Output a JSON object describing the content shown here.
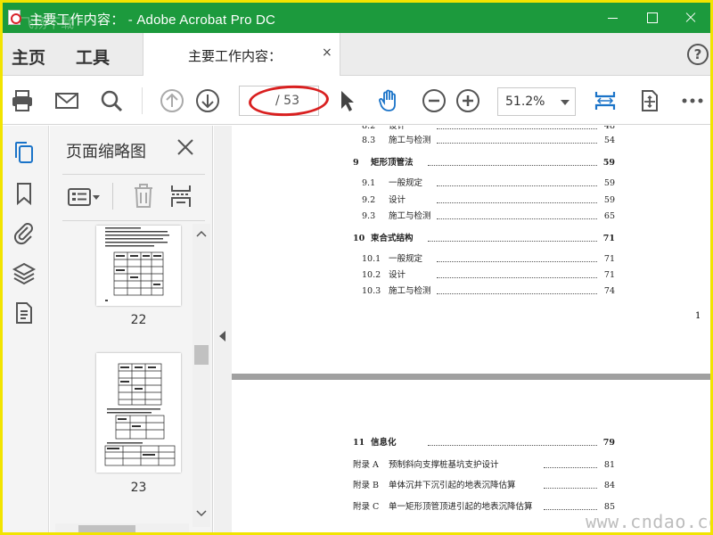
{
  "window": {
    "title": "主要工作内容： - Adobe Acrobat Pro DC",
    "watermark": "飞扬下载"
  },
  "tabs": {
    "home": "主页",
    "tools": "工具",
    "document": "主要工作内容：",
    "close": "×",
    "help": "?"
  },
  "toolbar": {
    "page_current": "",
    "page_total": "/ 53",
    "zoom": "51.2%"
  },
  "thumbnails": {
    "title": "页面缩略图",
    "pages": [
      {
        "label": "22"
      },
      {
        "label": "23"
      }
    ]
  },
  "toc_page_1": [
    {
      "num": "8.2",
      "title": "设计",
      "page": "48",
      "level": "section"
    },
    {
      "num": "8.3",
      "title": "施工与检测",
      "page": "54",
      "level": "section"
    },
    {
      "num": "9",
      "title": "矩形顶管法",
      "page": "59",
      "level": "chapter"
    },
    {
      "num": "9.1",
      "title": "一般规定",
      "page": "59",
      "level": "section"
    },
    {
      "num": "9.2",
      "title": "设计",
      "page": "59",
      "level": "section"
    },
    {
      "num": "9.3",
      "title": "施工与检测",
      "page": "65",
      "level": "section"
    },
    {
      "num": "10",
      "title": "束合式结构",
      "page": "71",
      "level": "chapter"
    },
    {
      "num": "10.1",
      "title": "一般规定",
      "page": "71",
      "level": "section"
    },
    {
      "num": "10.2",
      "title": "设计",
      "page": "71",
      "level": "section"
    },
    {
      "num": "10.3",
      "title": "施工与检测",
      "page": "74",
      "level": "section"
    }
  ],
  "page_number_1": "1",
  "toc_page_2": [
    {
      "num": "11",
      "title": "信息化",
      "page": "79",
      "level": "chapter"
    },
    {
      "num": "附录 A",
      "title": "预制斜向支撑桩基坑支护设计",
      "page": "81",
      "level": "appendix"
    },
    {
      "num": "附录 B",
      "title": "单体沉井下沉引起的地表沉降估算",
      "page": "84",
      "level": "appendix"
    },
    {
      "num": "附录 C",
      "title": "单一矩形顶管顶进引起的地表沉降估算",
      "page": "85",
      "level": "appendix"
    }
  ],
  "site_watermark": "www.cndao.com",
  "colors": {
    "titlebar": "#1c9a3d",
    "accent_blue": "#1a73c8",
    "frame": "#f2e400",
    "annotation_red": "#d92020"
  }
}
